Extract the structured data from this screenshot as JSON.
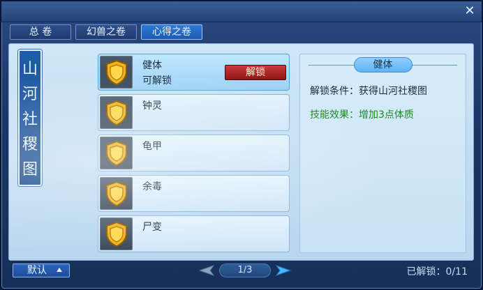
{
  "window": {
    "close_icon": "close-icon"
  },
  "tabs": [
    {
      "label": "总 卷",
      "active": false
    },
    {
      "label": "幻兽之卷",
      "active": false
    },
    {
      "label": "心得之卷",
      "active": true
    }
  ],
  "banner": {
    "text": [
      "山",
      "河",
      "社",
      "稷",
      "图"
    ]
  },
  "skills": [
    {
      "name": "健体",
      "status": "可解锁",
      "button": "解锁",
      "selected": true,
      "icon": "shield-icon"
    },
    {
      "name": "钟灵",
      "status": "",
      "button": "",
      "selected": false,
      "icon": "shield-icon"
    },
    {
      "name": "龟甲",
      "status": "",
      "button": "",
      "selected": false,
      "icon": "shield-icon"
    },
    {
      "name": "余毒",
      "status": "",
      "button": "",
      "selected": false,
      "icon": "shield-icon"
    },
    {
      "name": "尸变",
      "status": "",
      "button": "",
      "selected": false,
      "icon": "shield-icon"
    }
  ],
  "detail": {
    "title": "健体",
    "condition": "解锁条件：获得山河社稷图",
    "effect": "技能效果：增加3点体质"
  },
  "bottom": {
    "default_label": "默认",
    "page": "1/3",
    "unlocked_label": "已解锁：",
    "unlocked_count": "0/11"
  },
  "colors": {
    "accent": "#1d5bb3",
    "unlock_button": "#c83a3a",
    "effect_text": "#1e8a24"
  }
}
